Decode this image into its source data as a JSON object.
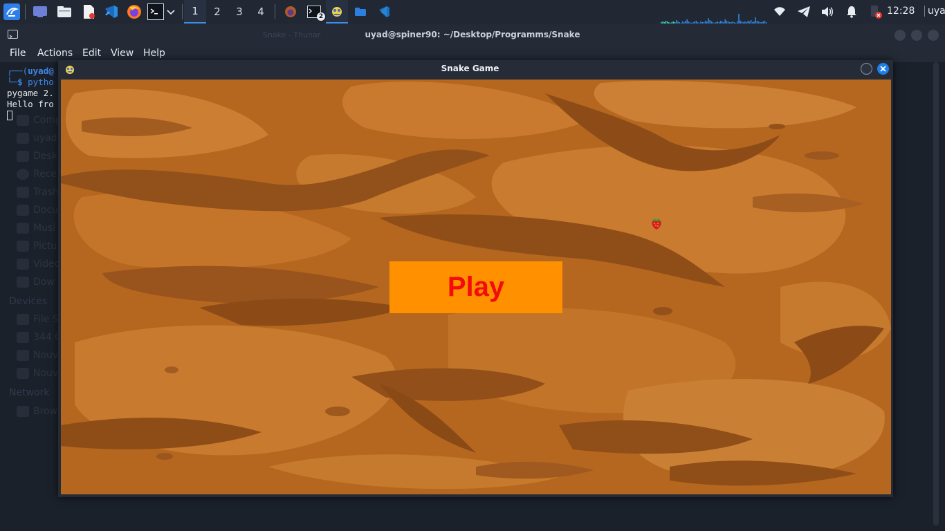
{
  "taskbar": {
    "workspaces": [
      "1",
      "2",
      "3",
      "4"
    ],
    "active_workspace": "1",
    "terminal_badge": "2",
    "clock": "12:28",
    "user": "uyad",
    "accent_color": "#3d8ee8"
  },
  "terminal": {
    "title": "uyad@spiner90: ~/Desktop/Programms/Snake",
    "ghost_title": "Snake - Thunar",
    "menu": [
      "File",
      "Actions",
      "Edit",
      "View",
      "Help"
    ],
    "lines": {
      "prompt_user": "uyad@",
      "command": "pytho",
      "out1": "pygame 2.",
      "out2": "Hello fro"
    },
    "sidebar_ghost": {
      "items": [
        "Comp",
        "uyad",
        "Desk",
        "Rece",
        "Trash",
        "Docu",
        "Musi",
        "Pictu",
        "Video",
        "Dow"
      ],
      "devices_heading": "Devices",
      "devices": [
        "File S",
        "344 G",
        "Nouv",
        "Nouv"
      ],
      "network_heading": "Network",
      "network": [
        "Brow"
      ]
    }
  },
  "game": {
    "window_title": "Snake Game",
    "play_label": "Play",
    "colors": {
      "background": "#b5661f",
      "button": "#ff9100",
      "button_text": "#f20c0c"
    }
  }
}
